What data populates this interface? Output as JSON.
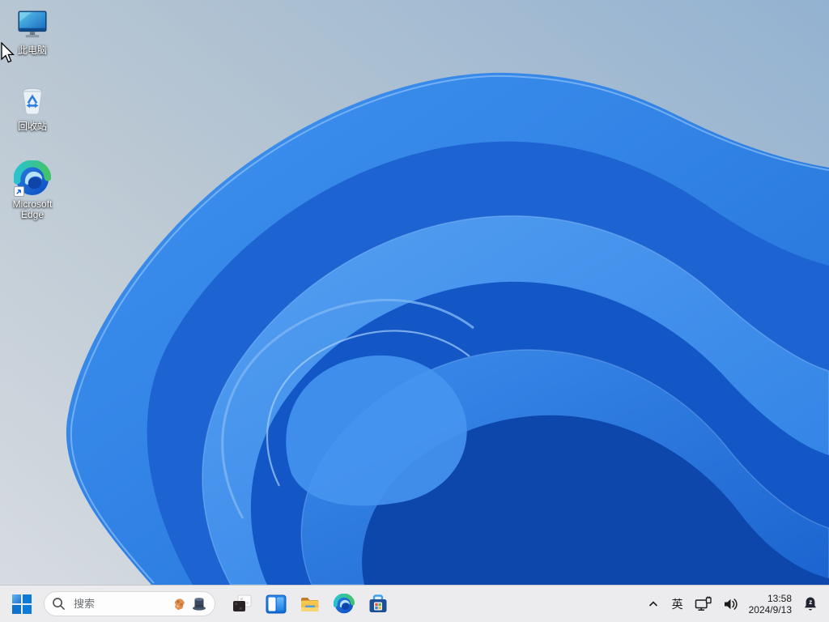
{
  "wallpaper": {
    "name": "windows-11-bloom",
    "background_top_right": "#97b5d2",
    "background_bottom_left": "#d6dce1",
    "bloom_primary": "#2e7fe2"
  },
  "desktop": {
    "icons": [
      {
        "id": "this-pc",
        "label": "此电脑"
      },
      {
        "id": "recycle-bin",
        "label": "回收站"
      },
      {
        "id": "edge-shortcut",
        "label": "Microsoft Edge"
      }
    ]
  },
  "taskbar": {
    "start": {
      "icon": "windows-logo"
    },
    "search": {
      "placeholder": "搜索",
      "icons": [
        "magnifier-icon",
        "search-highlight-creature-icon",
        "search-highlight-top-hat-icon"
      ]
    },
    "apps": [
      {
        "icon": "overlapping-windows-icon"
      },
      {
        "icon": "task-view-icon"
      },
      {
        "icon": "file-explorer-icon"
      },
      {
        "icon": "edge-icon"
      },
      {
        "icon": "microsoft-store-icon"
      }
    ],
    "tray": {
      "hidden_icons_icon": "chevron-up-icon",
      "ime_label": "英",
      "icons": [
        "ethernet-icon",
        "volume-icon"
      ],
      "time": "13:58",
      "date": "2024/9/13",
      "notification": {
        "icon": "bell-dnd-icon",
        "glyph": "z"
      }
    }
  },
  "colors": {
    "accent_blue": "#0d7bd6",
    "taskbar_bg": "#ececee",
    "search_placeholder": "#6b6f73",
    "tray_text": "#1a1a1a",
    "bloom_shadow": "#0e47ac",
    "bloom_highlight": "#4695ef"
  }
}
